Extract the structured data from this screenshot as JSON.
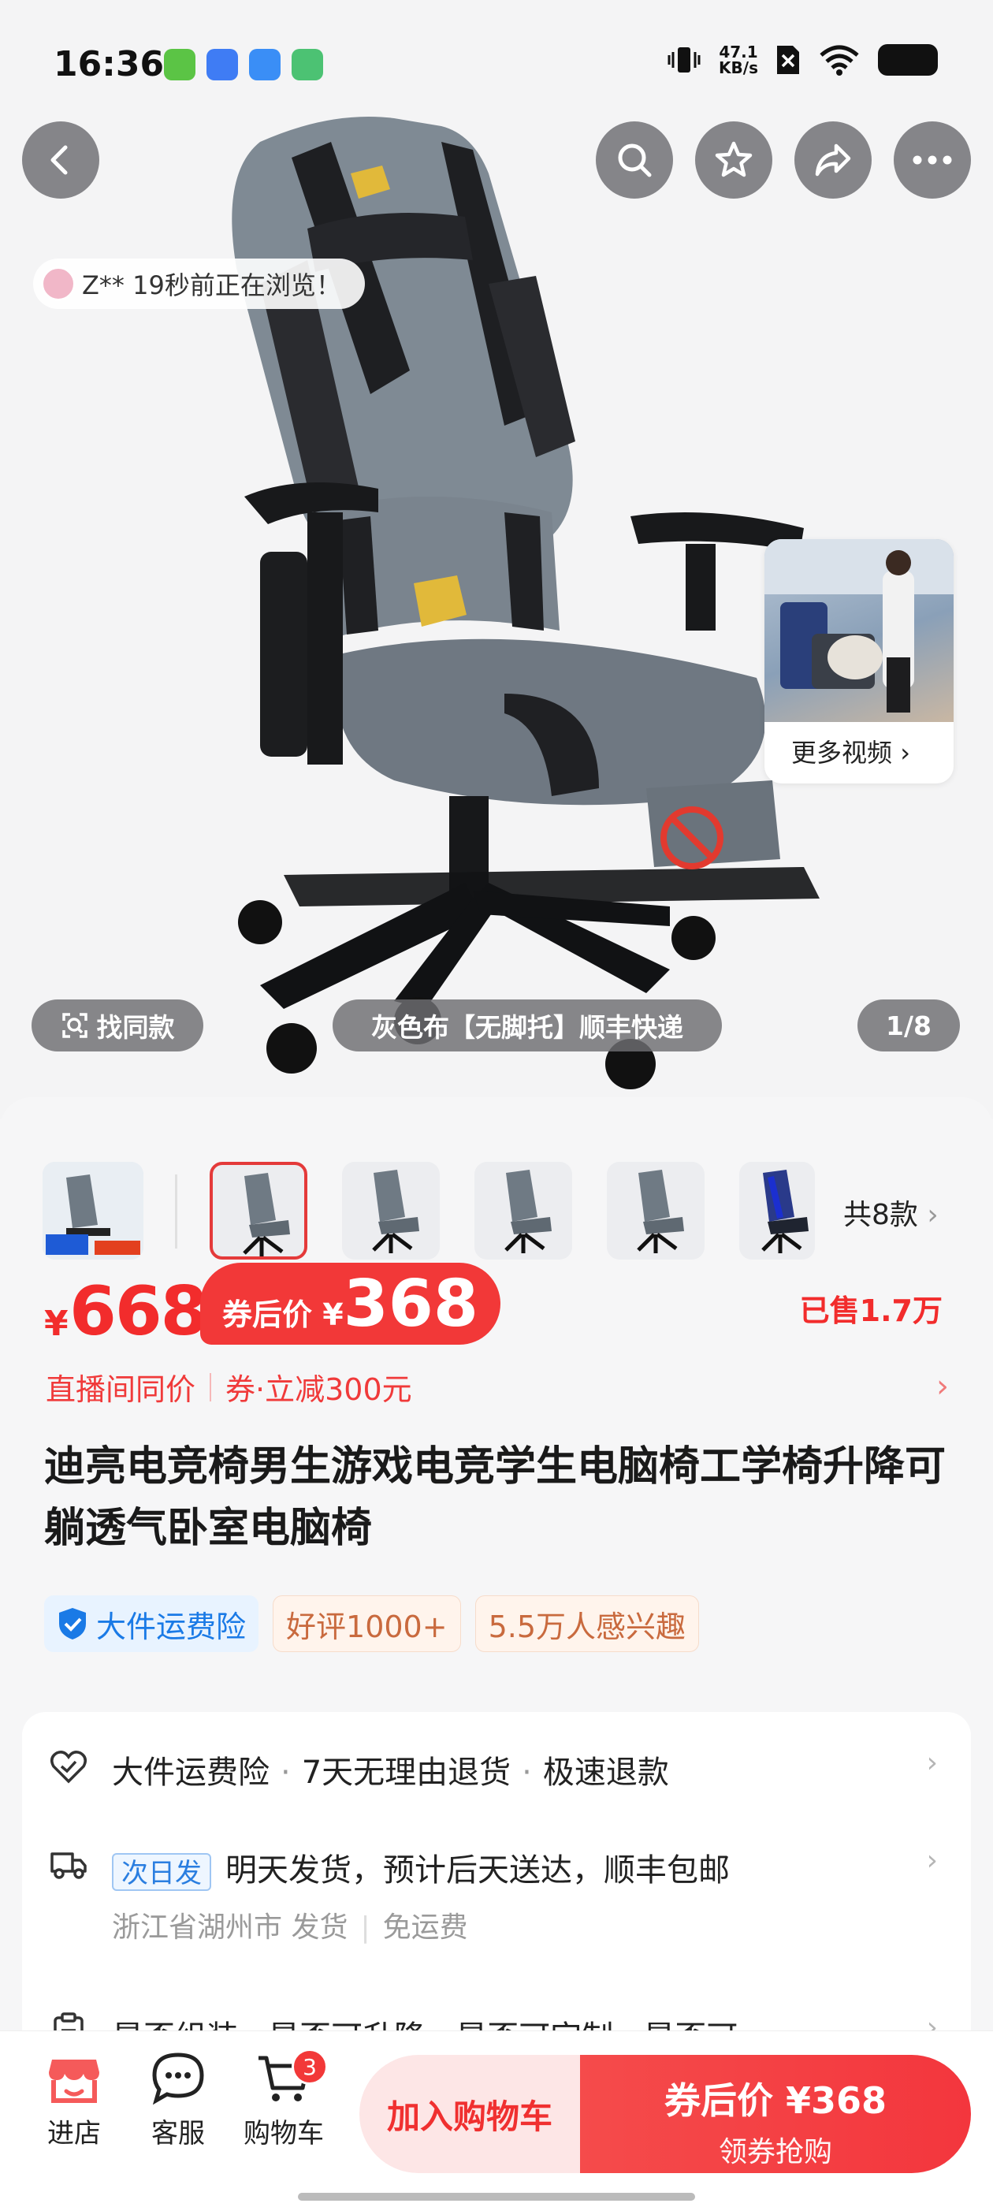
{
  "status_bar": {
    "time": "16:36",
    "net_speed_value": "47.1",
    "net_speed_unit": "KB/s",
    "app_icon_colors": [
      "#5bc445",
      "#3f7cf4",
      "#3a8ef6",
      "#4cc273"
    ]
  },
  "hero": {
    "browse_text": "Z** 19秒前正在浏览！",
    "more_videos_label": "更多视频",
    "find_similar_label": "找同款",
    "variant_label": "灰色布【无脚托】顺丰快递",
    "image_counter": "1/8",
    "icons": {
      "back": "back-arrow-icon",
      "search": "search-icon",
      "favorite": "star-icon",
      "share": "share-icon",
      "more": "more-dots-icon"
    }
  },
  "variants": {
    "count_label": "共8款",
    "selected_index": 0
  },
  "price": {
    "currency": "¥",
    "original": "668",
    "coupon_prefix": "券后价",
    "coupon_currency": "¥",
    "coupon_value": "368",
    "sold": "已售1.7万"
  },
  "promo": {
    "live_same_price": "直播间同价",
    "coupon_text": "券·立减300元"
  },
  "product_title": "迪亮电竞椅男生游戏电竞学生电脑椅工学椅升降可躺透气卧室电脑椅",
  "tags": [
    {
      "label": "大件运费险",
      "icon": "shield-check-icon"
    },
    {
      "label": "好评1000+"
    },
    {
      "label": "5.5万人感兴趣"
    }
  ],
  "services": {
    "guarantees": [
      "大件运费险",
      "7天无理由退货",
      "极速退款"
    ],
    "shipping_badge": "次日发",
    "shipping_text": "明天发货，预计后天送达，顺丰包邮",
    "shipping_origin": "浙江省湖州市 发货",
    "shipping_fee": "免运费",
    "attributes": "是否组装 · 是否可升降 · 是否可定制 · 是否可…"
  },
  "bottom_bar": {
    "shop_label": "进店",
    "service_label": "客服",
    "cart_label": "购物车",
    "cart_count": "3",
    "add_to_cart": "加入购物车",
    "buy_main": "券后价 ¥368",
    "buy_sub": "领券抢购"
  },
  "colors": {
    "accent_red": "#f23838",
    "link_blue": "#1a7ae6"
  }
}
